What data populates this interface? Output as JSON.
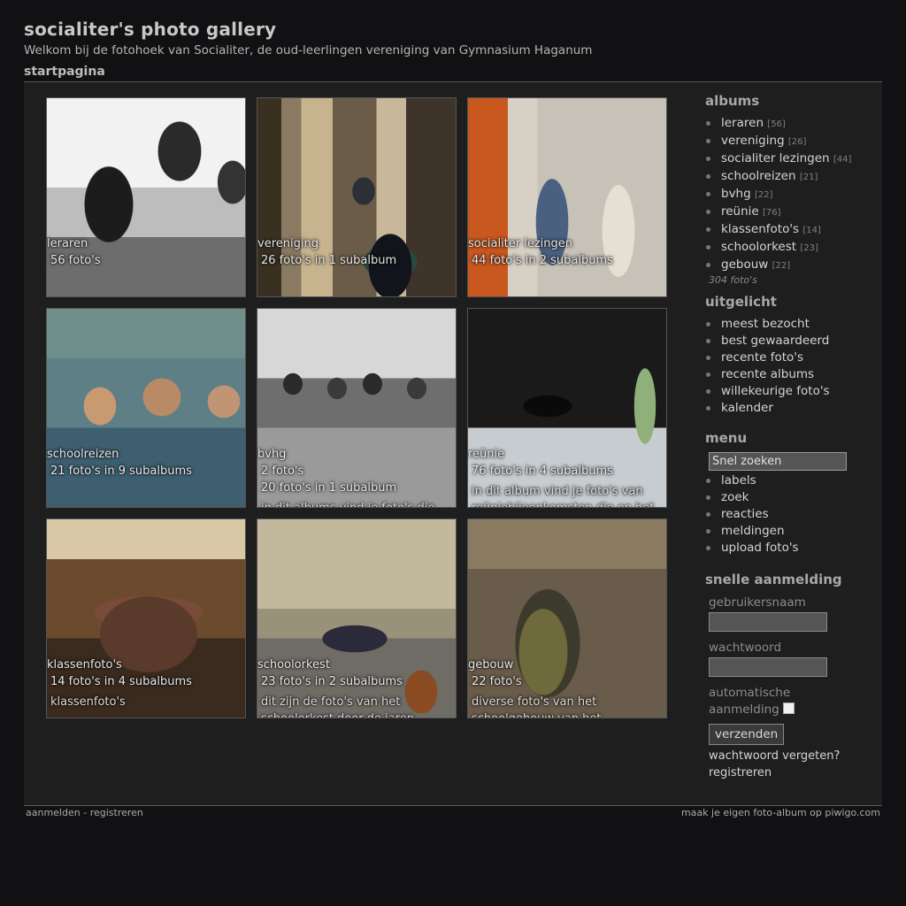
{
  "header": {
    "title": "socialiter's photo gallery",
    "subtitle": "Welkom bij de fotohoek van Socialiter, de oud-leerlingen vereniging van Gymnasium Haganum",
    "breadcrumb": "startpagina"
  },
  "albums_grid": [
    {
      "name": "leraren",
      "count": "56 foto's",
      "desc": ""
    },
    {
      "name": "vereniging",
      "count": "26 foto's in 1 subalbum",
      "desc": ""
    },
    {
      "name": "socialiter lezingen",
      "count": "44 foto's in 2 subalbums",
      "desc": ""
    },
    {
      "name": "schoolreizen",
      "count": "21 foto's in 9 subalbums",
      "desc": ""
    },
    {
      "name": "bvhg",
      "count": "2 foto's",
      "count2": "20 foto's in 1 subalbum",
      "desc": "in dit albums vind je foto's die"
    },
    {
      "name": "reünie",
      "count": "76 foto's in 4 subalbums",
      "desc": "in dit album vind je foto's van reüniebijeenkomsten die op het"
    },
    {
      "name": "klassenfoto's",
      "count": "14 foto's in 4 subalbums",
      "desc": "klassenfoto's"
    },
    {
      "name": "schoolorkest",
      "count": "23 foto's in 2 subalbums",
      "desc": "dit zijn de foto's van het schoolorkest door de jaren"
    },
    {
      "name": "gebouw",
      "count": "22 foto's",
      "desc": "diverse foto's van het schoolgebouw van het"
    }
  ],
  "sidebar": {
    "albums_title": "albums",
    "albums": [
      {
        "label": "leraren",
        "count": "[56]"
      },
      {
        "label": "vereniging",
        "count": "[26]"
      },
      {
        "label": "socialiter lezingen",
        "count": "[44]"
      },
      {
        "label": "schoolreizen",
        "count": "[21]"
      },
      {
        "label": "bvhg",
        "count": "[22]"
      },
      {
        "label": "reünie",
        "count": "[76]"
      },
      {
        "label": "klassenfoto's",
        "count": "[14]"
      },
      {
        "label": "schoolorkest",
        "count": "[23]"
      },
      {
        "label": "gebouw",
        "count": "[22]"
      }
    ],
    "albums_total": "304 foto's",
    "featured_title": "uitgelicht",
    "featured": [
      "meest bezocht",
      "best gewaardeerd",
      "recente foto's",
      "recente albums",
      "willekeurige foto's",
      "kalender"
    ],
    "menu_title": "menu",
    "search_value": "Snel zoeken",
    "menu": [
      "labels",
      "zoek",
      "reacties",
      "meldingen",
      "upload foto's"
    ],
    "login_title": "snelle aanmelding",
    "username_label": "gebruikersnaam",
    "password_label": "wachtwoord",
    "auto_login_label_1": "automatische",
    "auto_login_label_2": "aanmelding",
    "submit_label": "verzenden",
    "forgot_label": "wachtwoord vergeten?",
    "register_label": "registreren"
  },
  "footer": {
    "login": "aanmelden",
    "separator": " - ",
    "register": "registreren",
    "credit": "maak je eigen foto-album op piwigo.com"
  }
}
